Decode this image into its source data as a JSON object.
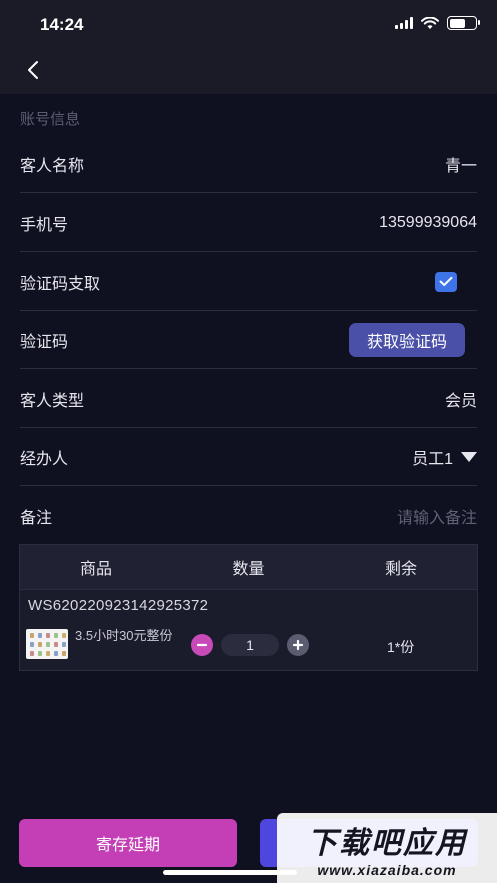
{
  "status": {
    "time": "14:24"
  },
  "section_title": "账号信息",
  "rows": {
    "guest_name": {
      "label": "客人名称",
      "value": "青一"
    },
    "phone": {
      "label": "手机号",
      "value": "13599939064"
    },
    "verify_pay": {
      "label": "验证码支取",
      "checked": true
    },
    "code": {
      "label": "验证码",
      "button": "获取验证码"
    },
    "guest_type": {
      "label": "客人类型",
      "value": "会员"
    },
    "handler": {
      "label": "经办人",
      "value": "员工1"
    },
    "remark": {
      "label": "备注",
      "placeholder": "请输入备注"
    }
  },
  "table": {
    "headers": [
      "商品",
      "数量",
      "剩余"
    ],
    "order_no": "WS620220923142925372",
    "item": {
      "name": "3.5小时30元整份",
      "quantity": "1",
      "remaining": "1*份"
    }
  },
  "buttons": {
    "extend": "寄存延期"
  },
  "watermark": {
    "main": "下载吧应用",
    "sub": "www.xiazaiba.com"
  },
  "colors": {
    "accent_pink": "#c43fb6",
    "accent_blue": "#4f46e0",
    "checkbox": "#3e74e8"
  }
}
